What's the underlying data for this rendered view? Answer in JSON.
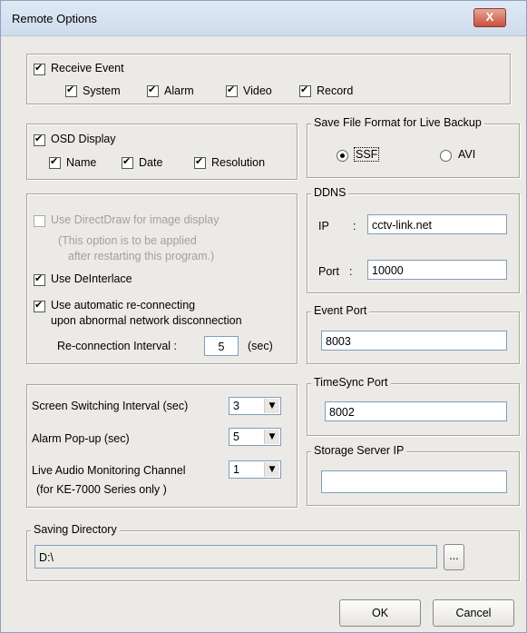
{
  "window": {
    "title": "Remote Options",
    "close": "X"
  },
  "receive": {
    "label": "Receive Event",
    "system": "System",
    "alarm": "Alarm",
    "video": "Video",
    "record": "Record"
  },
  "osd": {
    "label": "OSD Display",
    "name": "Name",
    "date": "Date",
    "resolution": "Resolution"
  },
  "savefmt": {
    "legend": "Save File Format for Live Backup",
    "ssf": "SSF",
    "avi": "AVI",
    "selected": "SSF"
  },
  "display": {
    "directdraw": "Use DirectDraw for image display",
    "note1": "(This option is to be applied",
    "note2": "after restarting this program.)",
    "deinterlace": "Use DeInterlace",
    "reconnect1": "Use automatic re-connecting",
    "reconnect2": "upon abnormal network disconnection",
    "interval_label": "Re-connection Interval :",
    "interval_value": "5",
    "interval_unit": "(sec)"
  },
  "ddns": {
    "legend": "DDNS",
    "ip_label": "IP",
    "ip_sep": ":",
    "ip_value": "cctv-link.net",
    "port_label": "Port",
    "port_sep": ":",
    "port_value": "10000"
  },
  "event_port": {
    "legend": "Event Port",
    "value": "8003"
  },
  "timesync": {
    "legend": "TimeSync Port",
    "value": "8002"
  },
  "storage": {
    "legend": "Storage Server IP",
    "value": ""
  },
  "switching": {
    "screen_label": "Screen Switching Interval (sec)",
    "screen_value": "3",
    "alarm_label": "Alarm Pop-up (sec)",
    "alarm_value": "5",
    "audio_label": "Live Audio Monitoring Channel",
    "audio_value": "1",
    "audio_note": "(for KE-7000 Series only )"
  },
  "saving": {
    "legend": "Saving Directory",
    "value": "D:\\",
    "browse": "..."
  },
  "buttons": {
    "ok": "OK",
    "cancel": "Cancel"
  },
  "icons": {
    "dropdown": "▼"
  }
}
